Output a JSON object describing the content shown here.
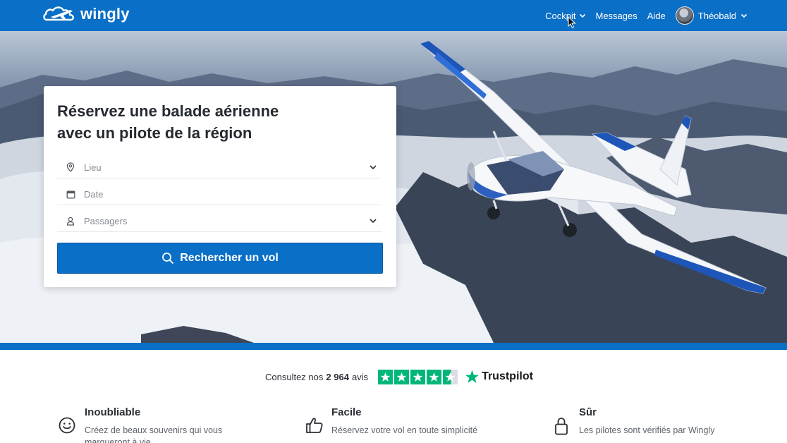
{
  "brand": {
    "name": "wingly"
  },
  "nav": {
    "cockpit": "Cockpit",
    "messages": "Messages",
    "aide": "Aide",
    "user": "Théobald"
  },
  "search_card": {
    "title_line1": "Réservez une balade aérienne",
    "title_line2": "avec un pilote de la région",
    "lieu_placeholder": "Lieu",
    "date_placeholder": "Date",
    "passagers_placeholder": "Passagers",
    "search_button": "Rechercher un vol"
  },
  "trust": {
    "prefix": "Consultez nos",
    "count": "2 964",
    "suffix": "avis",
    "rating": 4.5,
    "rating_max": 5,
    "brand": "Trustpilot"
  },
  "features": [
    {
      "title": "Inoubliable",
      "desc": "Créez de beaux souvenirs qui vous marqueront à vie",
      "icon": "smile-icon"
    },
    {
      "title": "Facile",
      "desc": "Réservez votre vol en toute simplicité",
      "icon": "thumbs-up-icon"
    },
    {
      "title": "Sûr",
      "desc": "Les pilotes sont vérifiés par Wingly",
      "icon": "lock-icon"
    }
  ],
  "colors": {
    "brand_blue": "#0a6fc6",
    "trustpilot_green": "#00b67a"
  }
}
